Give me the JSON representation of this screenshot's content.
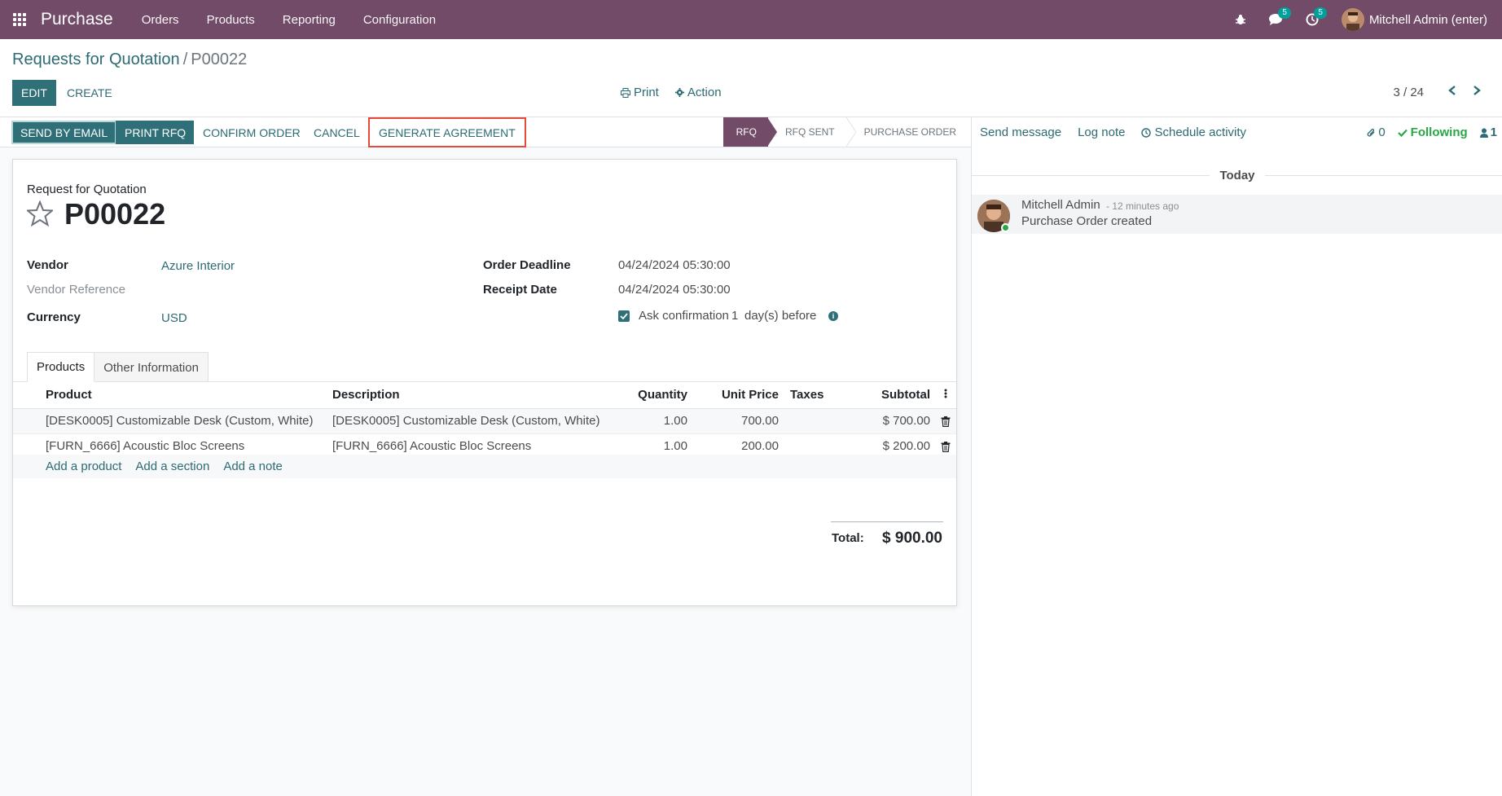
{
  "navbar": {
    "app_name": "Purchase",
    "menu": [
      "Orders",
      "Products",
      "Reporting",
      "Configuration"
    ],
    "messages_count": "5",
    "activities_count": "5",
    "user_name": "Mitchell Admin (enter)"
  },
  "control_panel": {
    "breadcrumb_parent": "Requests for Quotation",
    "breadcrumb_separator": "/",
    "breadcrumb_current": "P00022",
    "edit_label": "EDIT",
    "create_label": "CREATE",
    "print_label": "Print",
    "action_label": "Action",
    "pager": "3 / 24"
  },
  "statusbar": {
    "buttons": [
      "SEND BY EMAIL",
      "PRINT RFQ",
      "CONFIRM ORDER",
      "CANCEL",
      "GENERATE AGREEMENT"
    ],
    "stages": [
      "RFQ",
      "RFQ SENT",
      "PURCHASE ORDER"
    ],
    "active_stage": "RFQ"
  },
  "form": {
    "doc_type": "Request for Quotation",
    "doc_number": "P00022",
    "vendor_label": "Vendor",
    "vendor_value": "Azure Interior",
    "vendor_ref_label": "Vendor Reference",
    "currency_label": "Currency",
    "currency_value": "USD",
    "order_deadline_label": "Order Deadline",
    "order_deadline_value": "04/24/2024 05:30:00",
    "receipt_date_label": "Receipt Date",
    "receipt_date_value": "04/24/2024 05:30:00",
    "ask_confirmation_label": "Ask confirmation",
    "ask_confirmation_days": "1",
    "ask_confirmation_suffix": "day(s) before",
    "tabs": [
      "Products",
      "Other Information"
    ],
    "columns": [
      "Product",
      "Description",
      "Quantity",
      "Unit Price",
      "Taxes",
      "Subtotal"
    ],
    "lines": [
      {
        "product": "[DESK0005] Customizable Desk (Custom, White)",
        "description": "[DESK0005] Customizable Desk (Custom, White)",
        "quantity": "1.00",
        "unit_price": "700.00",
        "taxes": "",
        "subtotal": "$ 700.00"
      },
      {
        "product": "[FURN_6666] Acoustic Bloc Screens",
        "description": "[FURN_6666] Acoustic Bloc Screens",
        "quantity": "1.00",
        "unit_price": "200.00",
        "taxes": "",
        "subtotal": "$ 200.00"
      }
    ],
    "add_product": "Add a product",
    "add_section": "Add a section",
    "add_note": "Add a note",
    "total_label": "Total:",
    "total_value": "$ 900.00"
  },
  "chatter": {
    "send_message": "Send message",
    "log_note": "Log note",
    "schedule_activity": "Schedule activity",
    "attachments_count": "0",
    "following_label": "Following",
    "followers_count": "1",
    "date_separator": "Today",
    "message_author": "Mitchell Admin",
    "message_time": "- 12 minutes ago",
    "message_body": "Purchase Order created"
  },
  "colors": {
    "brand": "#714b67",
    "primary": "#2f6f77",
    "link": "#2c6b74",
    "highlight_border": "#e34a3a",
    "following": "#28a745"
  },
  "icons": [
    "apps-grid-icon",
    "bug-icon",
    "chat-icon",
    "clock-icon",
    "print-icon",
    "gear-icon",
    "chevron-left-icon",
    "chevron-right-icon",
    "star-icon",
    "info-icon",
    "trash-icon",
    "paperclip-icon",
    "check-icon",
    "user-icon",
    "schedule-clock-icon",
    "kebab-icon"
  ]
}
